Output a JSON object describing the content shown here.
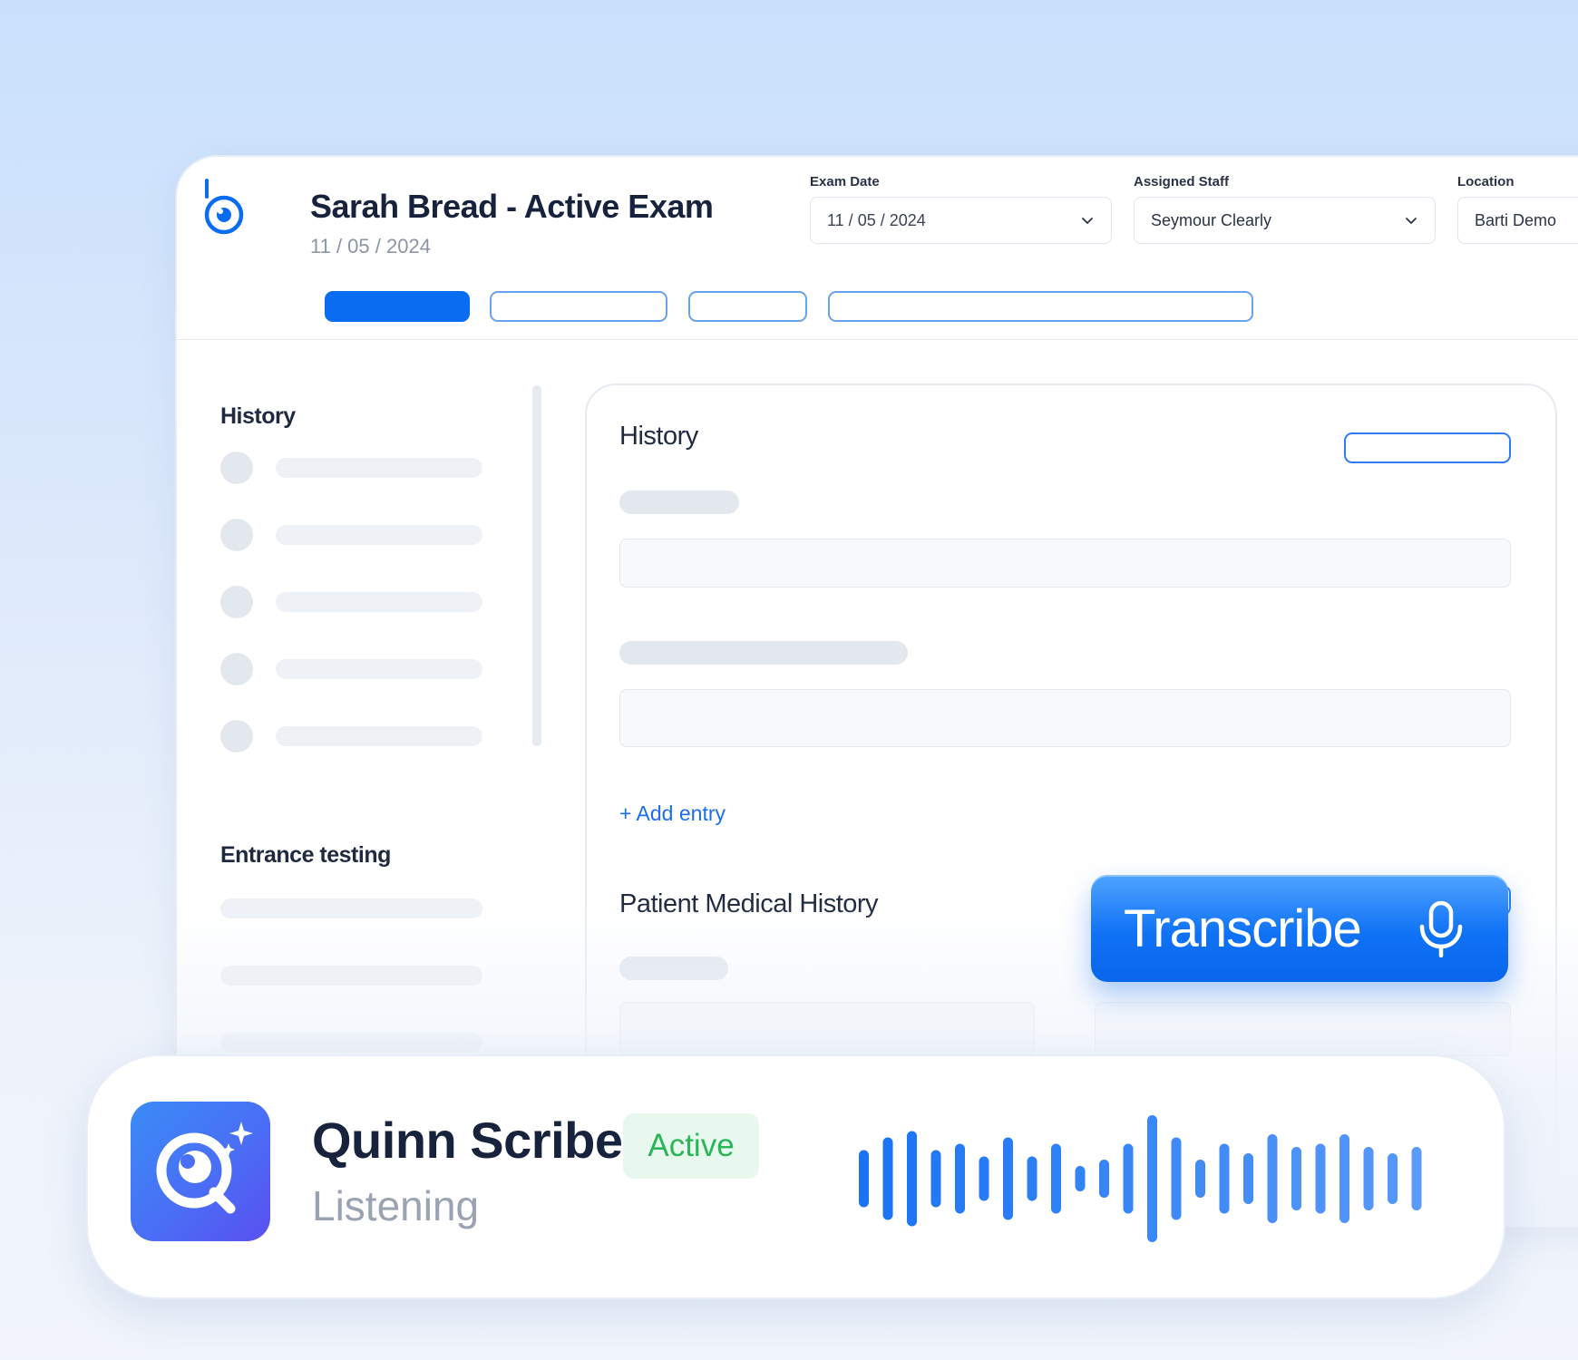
{
  "header": {
    "title": "Sarah Bread - Active Exam",
    "date": "11 / 05 / 2024",
    "exam_date": {
      "label": "Exam Date",
      "value": "11 / 05 / 2024"
    },
    "assigned_staff": {
      "label": "Assigned Staff",
      "value": "Seymour Clearly"
    },
    "location": {
      "label": "Location",
      "value": "Barti Demo"
    }
  },
  "sidebar": {
    "history_heading": "History",
    "entrance_heading": "Entrance testing"
  },
  "main": {
    "history_heading": "History",
    "add_entry": "+ Add entry",
    "medical_history_heading": "Patient Medical History"
  },
  "transcribe": {
    "label": "Transcribe",
    "icon": "microphone-icon"
  },
  "scribe": {
    "name": "Quinn Scribe",
    "status": "Listening",
    "badge": "Active",
    "icon": "quinn-scribe-logo-icon",
    "wave_levels": [
      0.45,
      0.65,
      0.75,
      0.45,
      0.55,
      0.35,
      0.65,
      0.35,
      0.55,
      0.2,
      0.3,
      0.55,
      1.0,
      0.65,
      0.3,
      0.55,
      0.4,
      0.7,
      0.5,
      0.55,
      0.7,
      0.5,
      0.4,
      0.5
    ],
    "wave_color": "#1a73f5"
  },
  "colors": {
    "accent": "#0a6cf0",
    "badge_bg": "#e8f8ee",
    "badge_text": "#2bb558"
  }
}
